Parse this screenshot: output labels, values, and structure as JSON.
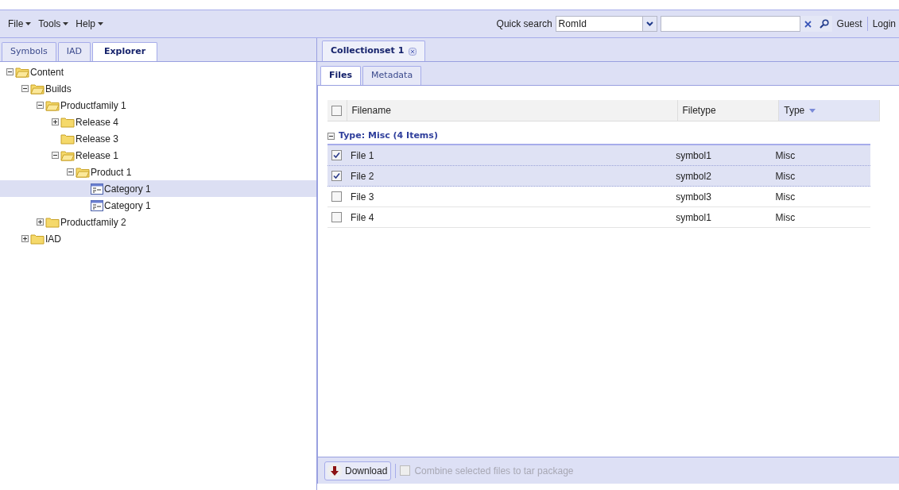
{
  "menu": [
    "File",
    "Tools",
    "Help"
  ],
  "quick_search": {
    "label": "Quick search",
    "field": "RomId"
  },
  "user": {
    "name": "Guest",
    "login": "Login"
  },
  "left_tabs": [
    {
      "label": "Symbols",
      "selected": false
    },
    {
      "label": "IAD",
      "selected": false
    },
    {
      "label": "Explorer",
      "selected": true
    }
  ],
  "tree": [
    {
      "label": "Content",
      "kind": "folder",
      "expanded": true,
      "selected": false,
      "children": [
        {
          "label": "Builds",
          "kind": "folder",
          "expanded": true,
          "selected": false,
          "children": [
            {
              "label": "Productfamily 1",
              "kind": "folder",
              "expanded": true,
              "selected": false,
              "children": [
                {
                  "label": "Release 4",
                  "kind": "folder",
                  "expanded": false,
                  "selected": false
                },
                {
                  "label": "Release 3",
                  "kind": "folder",
                  "selected": false
                },
                {
                  "label": "Release 1",
                  "kind": "folder",
                  "expanded": true,
                  "selected": false,
                  "children": [
                    {
                      "label": "Product 1",
                      "kind": "folder",
                      "expanded": true,
                      "selected": false,
                      "children": [
                        {
                          "label": "Category 1",
                          "kind": "category",
                          "selected": true
                        },
                        {
                          "label": "Category 1",
                          "kind": "category",
                          "selected": false
                        }
                      ]
                    }
                  ]
                }
              ]
            },
            {
              "label": "Productfamily 2",
              "kind": "folder",
              "expanded": false,
              "selected": false
            }
          ]
        },
        {
          "label": "IAD",
          "kind": "folder",
          "expanded": false,
          "selected": false
        }
      ]
    }
  ],
  "doc_tab": {
    "label": "Collectionset 1"
  },
  "sub_tabs": [
    {
      "label": "Files",
      "selected": true
    },
    {
      "label": "Metadata",
      "selected": false
    }
  ],
  "table": {
    "select_all": {
      "checked": false
    },
    "columns": [
      "Filename",
      "Filetype",
      "Type"
    ],
    "group": {
      "label": "Type: Misc (4 Items)",
      "expanded": true
    },
    "rows": [
      {
        "cells": [
          "File 1",
          "symbol1",
          "Misc"
        ],
        "checked": true
      },
      {
        "cells": [
          "File 2",
          "symbol2",
          "Misc"
        ],
        "checked": true
      },
      {
        "cells": [
          "File 3",
          "symbol3",
          "Misc"
        ],
        "checked": false
      },
      {
        "cells": [
          "File 4",
          "symbol1",
          "Misc"
        ],
        "checked": false
      }
    ]
  },
  "footer": {
    "download": "Download",
    "combine": {
      "label": "Combine selected files to tar package",
      "checked": false,
      "disabled": true
    }
  }
}
